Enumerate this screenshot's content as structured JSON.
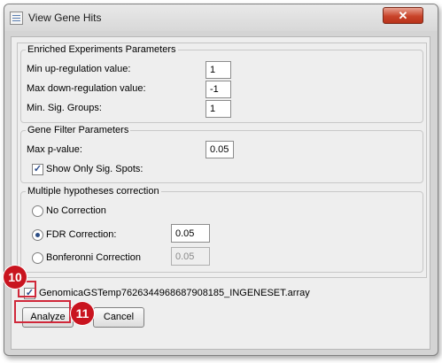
{
  "window": {
    "title": "View Gene Hits",
    "close_label": "✕"
  },
  "enriched": {
    "legend": "Enriched Experiments Parameters",
    "min_up_label": "Min up-regulation value:",
    "min_up_value": "1",
    "max_down_label": "Max down-regulation value:",
    "max_down_value": "-1",
    "min_sig_label": "Min. Sig. Groups:",
    "min_sig_value": "1"
  },
  "gene_filter": {
    "legend": "Gene Filter Parameters",
    "max_p_label": "Max p-value:",
    "max_p_value": "0.05",
    "show_sig_label": "Show Only Sig. Spots:",
    "show_sig_checked": true
  },
  "correction": {
    "legend": "Multiple hypotheses correction",
    "options": [
      {
        "label": "No Correction",
        "selected": false
      },
      {
        "label": "FDR Correction:",
        "selected": true,
        "value": "0.05"
      },
      {
        "label": "Bonferonni Correction",
        "selected": false,
        "value": "0.05"
      }
    ]
  },
  "file": {
    "label": "GenomicaGSTemp7626344968687908185_INGENESET.array",
    "checked": true
  },
  "buttons": {
    "analyze": "Analyze",
    "cancel": "Cancel"
  },
  "annotations": {
    "badge_file": "10",
    "badge_analyze": "11",
    "highlight_color": "#d0283a"
  }
}
